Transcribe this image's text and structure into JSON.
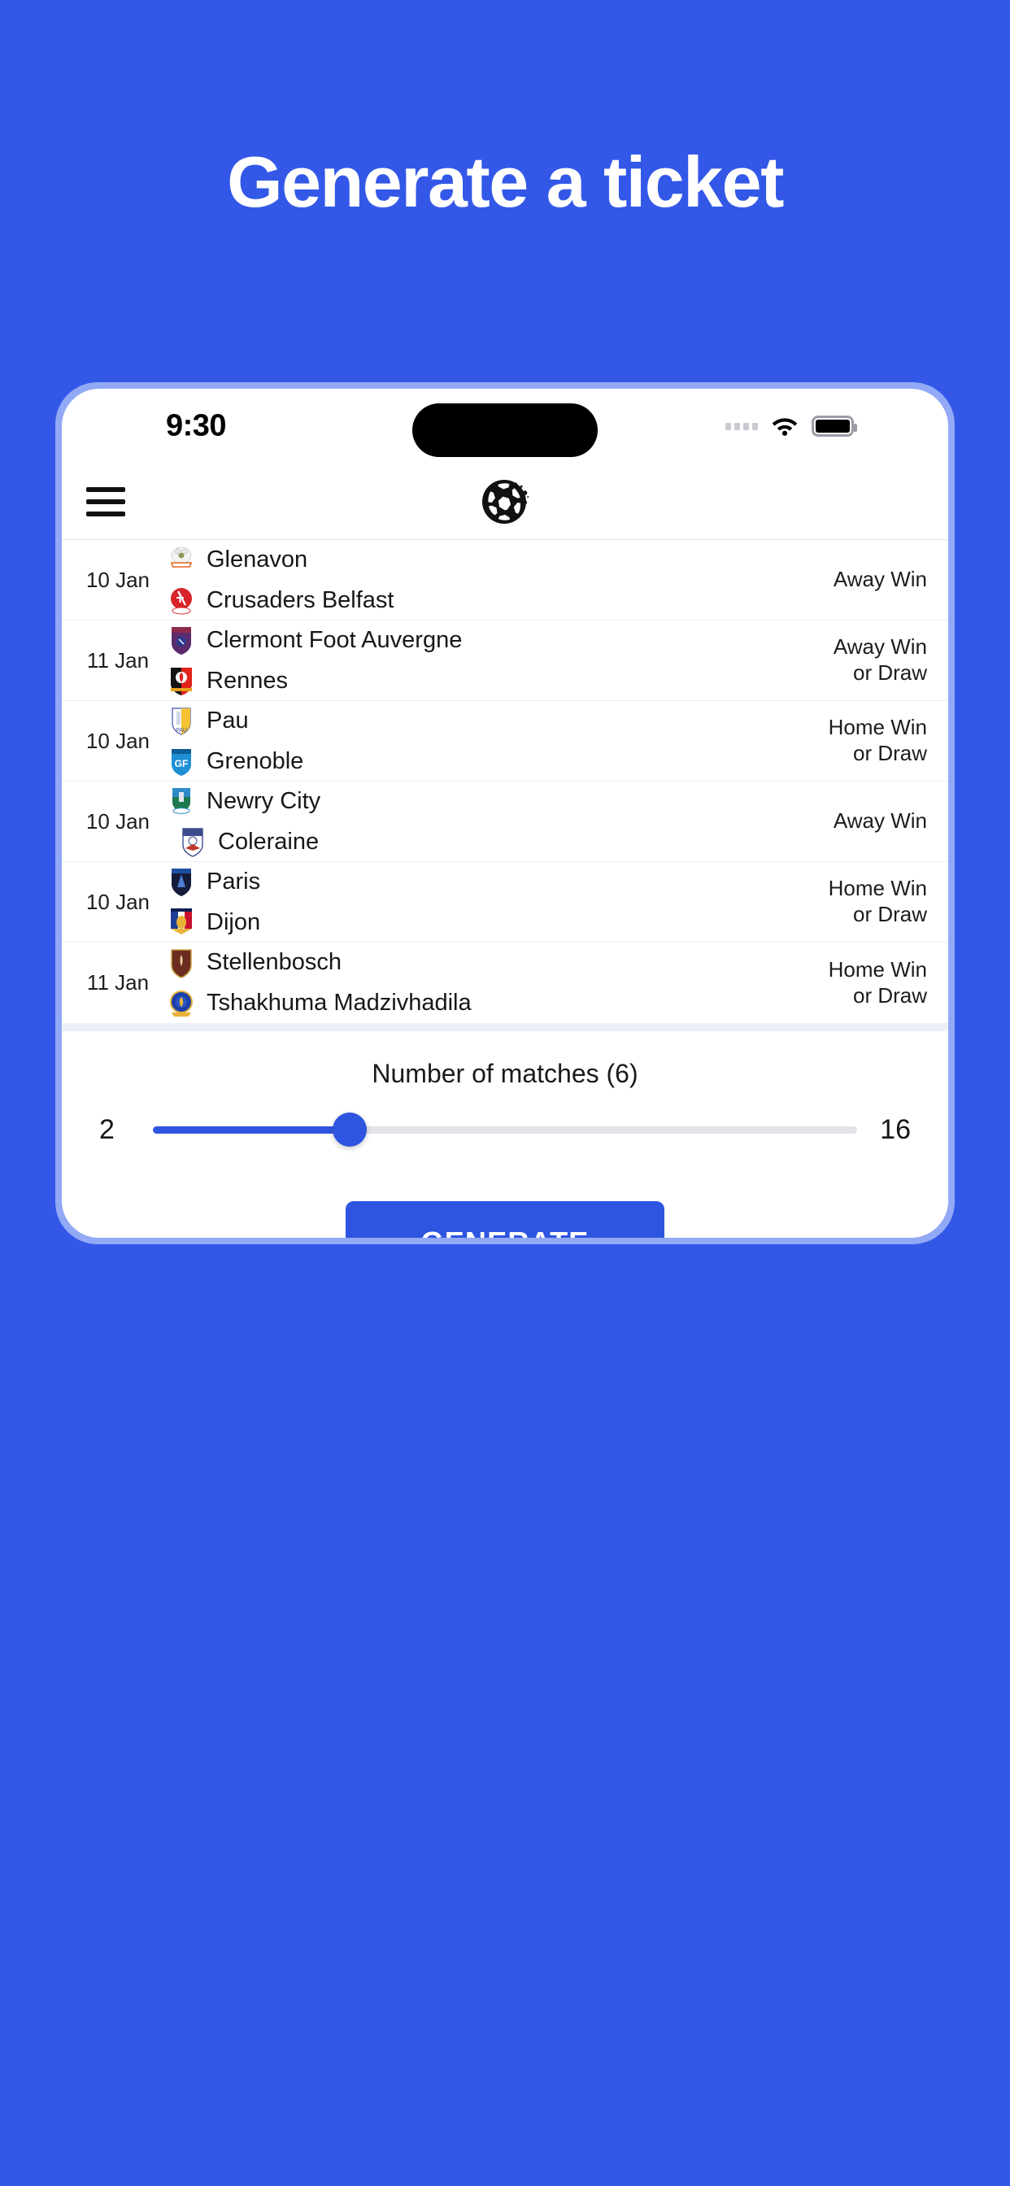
{
  "page": {
    "background_color": "#3358E8",
    "headline": "Generate a ticket"
  },
  "phone": {
    "frame_color": "#92A9F5",
    "status_bar": {
      "time": "9:30",
      "icons": [
        "signal-dots",
        "wifi-icon",
        "battery-icon"
      ]
    },
    "app_header": {
      "menu_icon": "hamburger-icon",
      "logo": "soccer-ball-logo"
    }
  },
  "matches": {
    "rows": [
      {
        "date": "10 Jan",
        "home_team": "Glenavon",
        "away_team": "Crusaders Belfast",
        "prediction": "Away Win"
      },
      {
        "date": "11 Jan",
        "home_team": "Clermont Foot Auvergne",
        "away_team": "Rennes",
        "prediction": "Away Win\nor Draw"
      },
      {
        "date": "10 Jan",
        "home_team": "Pau",
        "away_team": "Grenoble",
        "prediction": "Home Win\nor Draw"
      },
      {
        "date": "10 Jan",
        "home_team": "Newry City",
        "away_team": "Coleraine",
        "prediction": "Away Win"
      },
      {
        "date": "10 Jan",
        "home_team": "Paris",
        "away_team": "Dijon",
        "prediction": "Home Win\nor Draw"
      },
      {
        "date": "11 Jan",
        "home_team": "Stellenbosch",
        "away_team": "Tshakhuma Madzivhadila",
        "prediction": "Home Win\nor Draw"
      }
    ]
  },
  "slider": {
    "title": "Number of matches (6)",
    "min_label": "2",
    "max_label": "16",
    "min": 2,
    "max": 16,
    "value": 6,
    "fill_percent": 28,
    "accent_color": "#2E55E0",
    "track_color": "#e3e3e8"
  },
  "actions": {
    "generate_label": "GENERATE",
    "generate_color": "#2E55E0"
  },
  "bottom_nav": {
    "items": [
      {
        "icon": "home-icon",
        "active": false
      },
      {
        "icon": "list-icon",
        "active": true
      },
      {
        "icon": "pie-chart-icon",
        "active": false
      },
      {
        "icon": "film-strip-icon",
        "active": false
      },
      {
        "icon": "article-icon",
        "active": false
      }
    ],
    "active_color": "#2E55E0",
    "inactive_color": "#a9adba"
  }
}
